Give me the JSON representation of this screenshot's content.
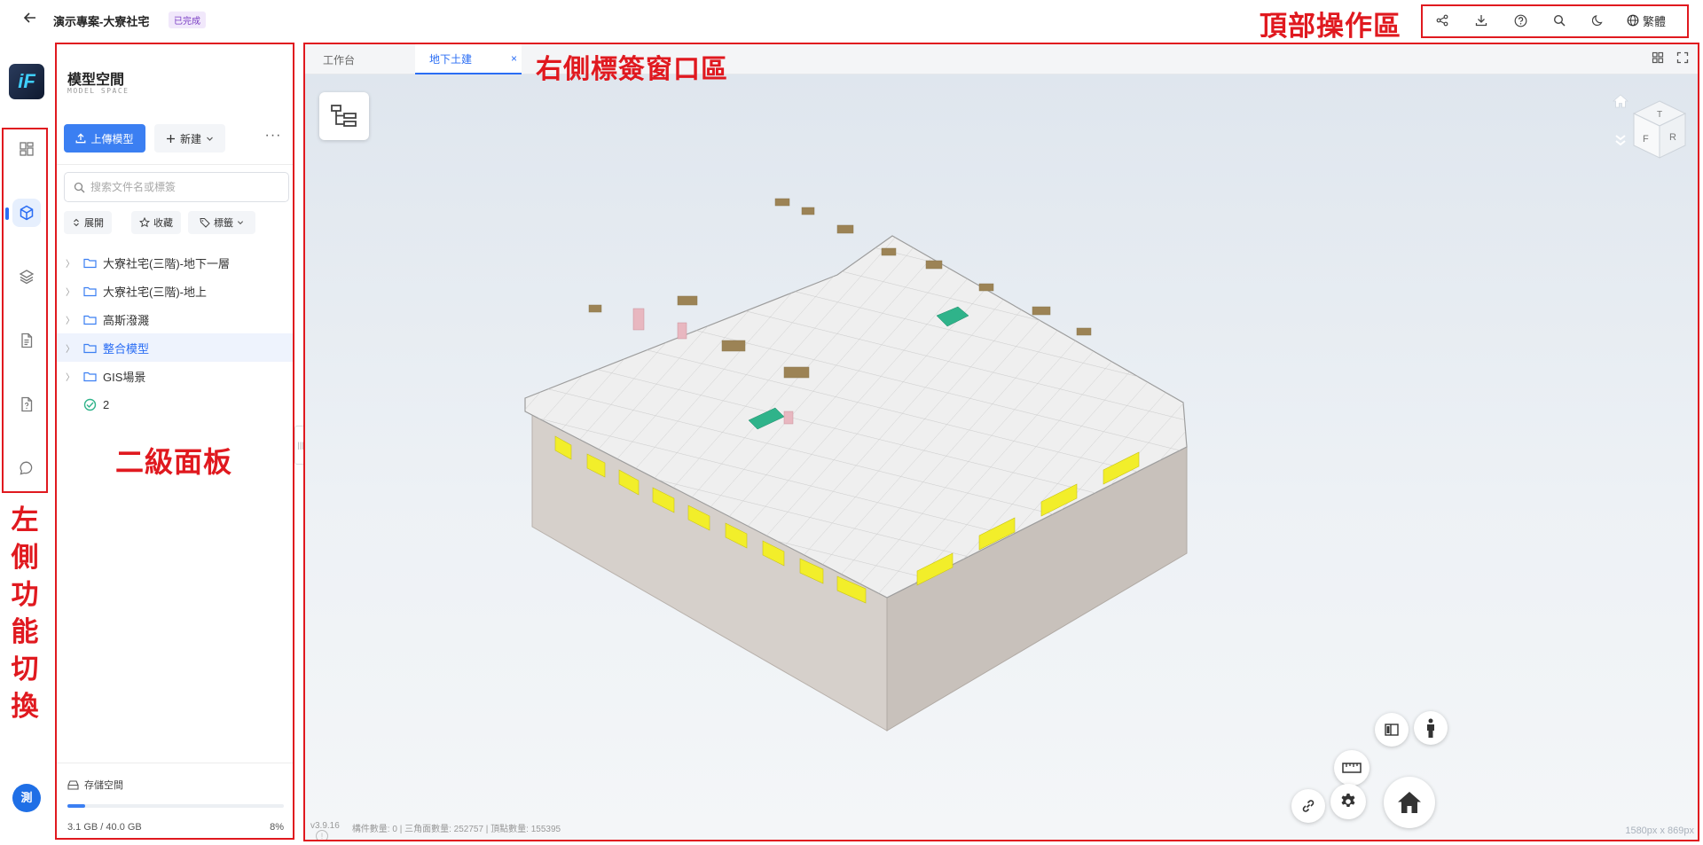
{
  "header": {
    "back_icon": "arrow-left-icon",
    "project_title": "演示專案-大寮社宅",
    "status_badge": "已完成",
    "toolbar": {
      "icons": [
        "share-icon",
        "download-icon",
        "help-icon",
        "search-icon",
        "moon-icon"
      ],
      "language_label": "繁體"
    }
  },
  "annotations": {
    "top_area": "頂部操作區",
    "right_tab_area": "右側標簽窗口區",
    "secondary_panel": "二級面板",
    "left_switch": "左側功能切換"
  },
  "left_rail": {
    "logo_text": "iF",
    "items": [
      {
        "icon": "dashboard-icon",
        "active": false
      },
      {
        "icon": "cube-icon",
        "active": true
      },
      {
        "icon": "layers-icon",
        "active": false
      },
      {
        "icon": "document-icon",
        "active": false
      },
      {
        "icon": "file-question-icon",
        "active": false
      },
      {
        "icon": "chat-icon",
        "active": false
      }
    ],
    "avatar_text": "測"
  },
  "panel": {
    "title": "模型空間",
    "subtitle": "MODEL SPACE",
    "upload_label": "上傳模型",
    "new_label": "新建",
    "more_label": "···",
    "search_placeholder": "搜索文件名或標簽",
    "filters": {
      "expand_label": "展開",
      "favorite_label": "收藏",
      "tag_label": "標籤"
    },
    "tree": [
      {
        "label": "大寮社宅(三階)-地下一層",
        "type": "folder",
        "selected": false
      },
      {
        "label": "大寮社宅(三階)-地上",
        "type": "folder",
        "selected": false
      },
      {
        "label": "高斯潑濺",
        "type": "folder",
        "selected": false
      },
      {
        "label": "整合模型",
        "type": "folder",
        "selected": true
      },
      {
        "label": "GIS場景",
        "type": "folder",
        "selected": false
      },
      {
        "label": "2",
        "type": "model",
        "selected": false
      }
    ],
    "storage": {
      "title": "存儲空間",
      "used_text": "3.1 GB / 40.0 GB",
      "percent_text": "8%",
      "fraction": 0.08
    }
  },
  "viewer": {
    "tabs": [
      {
        "label": "工作台",
        "active": false
      },
      {
        "label": "地下土建",
        "active": true
      }
    ],
    "tab_close_label": "×",
    "status": {
      "version": "v3.9.16",
      "stats": "構件數量: 0 | 三角面數量: 252757 | 頂點數量: 155395"
    },
    "dims": "1580px x 869px",
    "navcube": {
      "top": "T",
      "front": "F",
      "right": "R"
    },
    "colors": {
      "accent": "#2a6df4",
      "model_yellow": "#f2ee2a",
      "model_green": "#2fb38a",
      "model_brown": "#9c8355",
      "model_pink": "#e8b7c0"
    }
  }
}
